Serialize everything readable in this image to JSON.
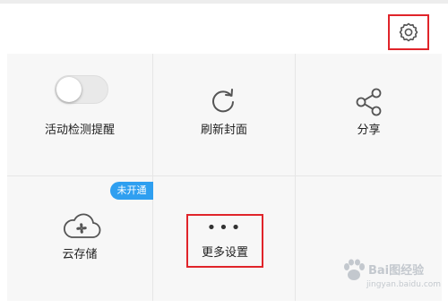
{
  "header": {
    "settings_icon": "gear-icon"
  },
  "tiles": [
    {
      "label": "活动检测提醒",
      "icon": "toggle-switch",
      "toggle_on": false
    },
    {
      "label": "刷新封面",
      "icon": "refresh-icon"
    },
    {
      "label": "分享",
      "icon": "share-icon"
    },
    {
      "label": "云存储",
      "icon": "cloud-icon",
      "badge": "未开通"
    },
    {
      "label": "更多设置",
      "icon": "more-dots-icon",
      "dots": "•••"
    }
  ],
  "watermark": {
    "text": "Bai图经验",
    "sub": "jingyan.baidu.com"
  },
  "colors": {
    "highlight": "#e0242a",
    "badge": "#2f9ff0",
    "icon": "#555555"
  }
}
